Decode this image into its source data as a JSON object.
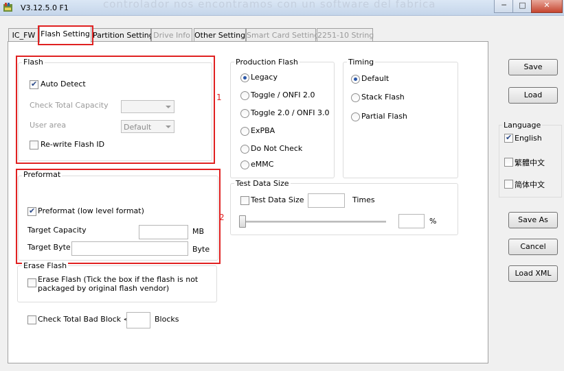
{
  "window": {
    "title": "V3.12.5.0 F1",
    "background_text": "controlador nos encontramos con un software del fabrica",
    "minimize": "─",
    "maximize": "□",
    "close": "✕"
  },
  "tabs": [
    {
      "label": "IC_FW"
    },
    {
      "label": "Flash Setting"
    },
    {
      "label": "Partition Setting"
    },
    {
      "label": "Drive Info"
    },
    {
      "label": "Other Setting"
    },
    {
      "label": "Smart Card Setting"
    },
    {
      "label": "2251-10 String"
    }
  ],
  "flash": {
    "title": "Flash",
    "auto_detect": "Auto Detect",
    "check_total_capacity": "Check Total Capacity",
    "user_area": "User area",
    "user_area_value": "Default",
    "rewrite_flash_id": "Re-write Flash ID"
  },
  "preformat": {
    "title": "Preformat",
    "preformat_label": "Preformat (low level format)",
    "target_capacity": "Target Capacity",
    "capacity_unit": "MB",
    "target_byte": "Target Byte",
    "byte_unit": "Byte"
  },
  "erase_flash": {
    "title": "Erase Flash",
    "label_line1": "Erase Flash (Tick the box if the flash is not",
    "label_line2": "packaged by original flash vendor)"
  },
  "bad_block": {
    "label": "Check Total Bad Block <",
    "unit": "Blocks"
  },
  "production_flash": {
    "title": "Production Flash",
    "options": [
      "Legacy",
      "Toggle / ONFI 2.0",
      "Toggle 2.0 / ONFI 3.0",
      "ExPBA",
      "Do Not Check",
      "eMMC"
    ],
    "selected": "Legacy"
  },
  "timing": {
    "title": "Timing",
    "options": [
      "Default",
      "Stack Flash",
      "Partial Flash"
    ],
    "selected": "Default"
  },
  "test_data": {
    "title": "Test Data Size",
    "checkbox_label": "Test Data Size",
    "times_label": "Times",
    "percent_label": "%",
    "slider_value": 0
  },
  "buttons": {
    "save": "Save",
    "load": "Load",
    "save_as": "Save As",
    "cancel": "Cancel",
    "load_xml": "Load XML"
  },
  "language": {
    "title": "Language",
    "options": [
      "English",
      "繁體中文",
      "简体中文"
    ],
    "selected": "English"
  },
  "annotations": {
    "marker1": "1",
    "marker2": "2"
  },
  "colors": {
    "annotation_red": "#e02020"
  }
}
